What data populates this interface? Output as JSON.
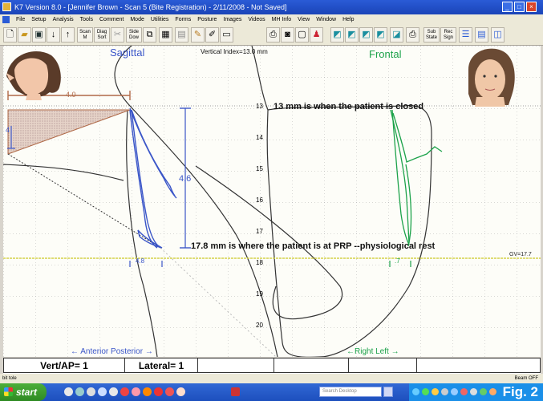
{
  "window": {
    "title": "K7 Version 8.0 - [Jennifer Brown - Scan 5 (Bite Registration) - 2/11/2008 - Not Saved]",
    "minimize": "_",
    "maximize": "□",
    "close": "×"
  },
  "menu": {
    "items": [
      "File",
      "Setup",
      "Analysis",
      "Tools",
      "Comment",
      "Mode",
      "Utilities",
      "Forms",
      "Posture",
      "Images",
      "Videos",
      "MH Info",
      "View",
      "Window",
      "Help"
    ]
  },
  "toolbar": {
    "scan": "Scan",
    "scan2": "M",
    "diag": "Diag",
    "diag2": "Sort",
    "side": "Side",
    "side2": "Dow",
    "sub": "Sub",
    "sub2": "State",
    "rec": "Rec",
    "rec2": "Sign"
  },
  "chart": {
    "sagittal_label": "Sagittal",
    "frontal_label": "Frontal",
    "vertical_index": "Vertical Index=13.0 mm",
    "ticks": [
      "13",
      "14",
      "15",
      "16",
      "17",
      "18",
      "19",
      "20"
    ],
    "top_bracket_value": "4.0",
    "left_value": "4",
    "vertical_bracket_value": "4.6",
    "sagittal_marker": "4.8",
    "frontal_marker": ".7",
    "gv_label": "GV=17.7",
    "anterior_posterior": "← Anterior  Posterior →",
    "right_left": "←Right   Left →",
    "annotation_closed": "13 mm is when the patient is closed",
    "annotation_rest": "17.8 mm is where the patient is at PRP --physiological rest"
  },
  "bottom": {
    "vert_ap": "Vert/AP= 1",
    "lateral": "Lateral= 1"
  },
  "status": {
    "left": "bit tole",
    "right": "Beam OFF"
  },
  "taskbar": {
    "start": "start",
    "search_placeholder": "Search Desktop",
    "fig_label": "Fig. 2"
  },
  "colors": {
    "blue": "#3b56c8",
    "green": "#1ca24a",
    "brown": "#b06a48",
    "accent": "#1f49c4"
  }
}
